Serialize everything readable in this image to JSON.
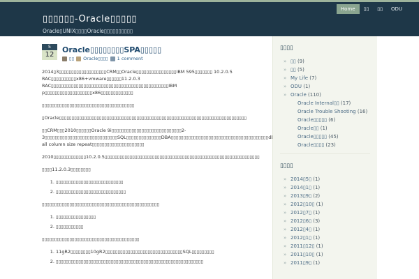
{
  "site": {
    "title": "▯▯▯▯▯▯-Oracle▯▯▯▯▯",
    "description": "Oracle▯UNIX▯▯▯▯Oracle▯▯▯▯▯▯▯▯▯▯"
  },
  "nav": [
    {
      "label": "Home",
      "active": true
    },
    {
      "label": "▯▯",
      "active": false
    },
    {
      "label": "▯▯",
      "active": false
    },
    {
      "label": "ODU",
      "active": false
    }
  ],
  "post": {
    "date_month": "5",
    "date_day": "12",
    "title": "Oracle▯▯▯▯▯▯▯▯SPA▯▯▯▯▯",
    "author": "▯▯",
    "category": "Oracle▯▯▯▯",
    "comments": "1 comment",
    "paragraphs": [
      "2014▯3▯▯▯▯▯▯▯▯▯▯▯▯▯▯▯▯▯▯▯CRM▯▯Oracle▯▯▯▯▯▯▯▯▯▯▯▯▯▯▯▯IBM 595▯▯▯▯▯▯▯ 10.2.0.5 RAC▯▯▯▯▯▯▯▯▯▯x86+vmware▯▯▯▯▯▯11.2.0.3 RAC▯▯▯▯▯▯▯▯▯▯▯▯▯▯▯▯▯▯▯▯▯▯▯▯▯▯▯▯▯▯▯▯▯▯▯▯▯▯▯▯▯▯▯▯▯▯▯IBM p▯▯▯▯▯▯▯▯▯▯▯▯▯▯▯▯▯▯▯x86▯▯▯▯▯▯▯▯▯▯▯▯▯",
      "▯▯▯▯▯▯▯▯▯▯▯▯▯▯▯▯▯▯▯▯▯▯▯▯▯▯▯▯▯▯▯▯▯▯▯▯▯",
      "▯Oracle▯▯▯▯▯▯▯▯▯▯▯▯▯▯▯▯▯▯▯▯▯▯▯▯▯▯▯▯▯▯▯▯▯▯▯▯▯▯▯▯▯▯▯▯▯▯▯▯▯▯▯▯▯▯▯▯▯▯▯▯▯▯▯▯▯▯▯▯▯▯▯▯▯▯▯",
      "▯▯CRM▯▯▯2010▯▯▯▯▯▯Oracle 9i▯▯▯▯▯▯▯▯▯▯▯▯▯▯▯▯▯▯▯▯▯▯▯▯▯▯▯▯2-3▯▯▯▯▯▯▯▯▯▯▯▯▯▯▯▯▯▯▯▯▯▯▯▯▯▯▯▯▯SQL▯▯▯▯▯▯▯▯▯▯▯▯▯▯DBA▯▯▯▯▯▯▯▯▯▯▯▯▯▯▯▯▯▯▯▯▯▯▯▯▯▯▯▯▯▯▯▯▯▯▯▯▯▯▯dbms_stats.gather_table_stats▯▯method_opt▯▯▯▯for all column size repeat▯▯▯▯▯▯▯▯▯▯▯▯▯▯▯▯▯▯▯▯▯",
      "2010▯▯▯▯▯▯▯▯▯▯▯▯▯10.2.0.5▯▯▯▯▯▯▯▯▯▯▯▯▯▯▯▯▯▯▯▯▯▯▯▯▯▯▯▯▯▯▯▯▯▯▯▯▯▯▯▯▯▯▯▯▯▯▯▯▯▯▯▯▯▯▯▯▯▯▯▯▯▯",
      "▯▯▯▯11.2.0.3▯▯▯▯▯▯▯▯"
    ],
    "list1": [
      "▯▯▯▯▯▯▯▯▯▯▯▯▯▯▯▯▯▯▯▯▯▯▯▯▯▯▯",
      "▯▯▯▯▯▯▯▯▯▯▯▯▯▯▯▯▯▯▯▯▯▯▯▯▯▯▯▯"
    ],
    "paragraph_after_list1": "▯▯▯▯▯▯▯▯▯▯▯▯▯▯▯▯▯▯▯▯▯▯▯▯▯▯▯▯▯▯▯▯▯▯▯▯▯▯▯▯▯▯▯▯▯▯▯",
    "list2": [
      "▯▯▯▯▯▯▯▯▯▯▯▯▯▯▯▯",
      "▯▯▯▯▯▯▯▯▯▯▯"
    ],
    "paragraph_after_list2": "▯▯▯▯▯▯▯▯▯▯▯▯▯▯▯▯▯▯▯▯▯▯▯▯▯▯▯▯▯▯▯▯▯▯▯▯▯▯▯",
    "list3": [
      "11gR2▯▯▯▯▯▯▯▯10gR2▯▯▯▯▯▯▯▯▯▯▯▯▯▯▯▯▯▯▯▯▯▯▯▯▯▯▯▯▯▯▯SQL▯▯▯▯▯▯▯▯▯",
      "▯▯▯▯▯▯▯▯▯▯▯▯▯▯▯▯▯▯▯▯▯▯▯▯▯▯▯▯▯▯▯▯▯▯▯▯▯▯▯▯▯▯▯▯▯▯▯▯▯▯▯▯▯▯▯▯▯▯▯"
    ]
  },
  "sidebar": {
    "categories_title": "▯▯▯▯",
    "categories": [
      {
        "label": "▯▯",
        "count": "(9)"
      },
      {
        "label": "▯▯",
        "count": "(5)"
      },
      {
        "label": "My Life",
        "count": "(7)"
      },
      {
        "label": "ODU",
        "count": "(1)"
      },
      {
        "label": "Oracle",
        "count": "(110)"
      }
    ],
    "oracle_children": [
      {
        "label": "Oracle Internal▯▯",
        "count": "(17)"
      },
      {
        "label": "Oracle Trouble Shooting",
        "count": "(16)"
      },
      {
        "label": "Oracle▯▯▯▯▯",
        "count": "(6)"
      },
      {
        "label": "Oracle▯▯",
        "count": "(1)"
      },
      {
        "label": "Oracle▯▯▯▯▯",
        "count": "(45)"
      },
      {
        "label": "Oracle▯▯▯▯",
        "count": "(23)"
      }
    ],
    "archives_title": "▯▯▯▯",
    "archives": [
      {
        "label": "2014▯5▯",
        "count": "(1)"
      },
      {
        "label": "2014▯1▯",
        "count": "(1)"
      },
      {
        "label": "2013▯9▯",
        "count": "(2)"
      },
      {
        "label": "2012▯10▯",
        "count": "(1)"
      },
      {
        "label": "2012▯7▯",
        "count": "(1)"
      },
      {
        "label": "2012▯6▯",
        "count": "(3)"
      },
      {
        "label": "2012▯4▯",
        "count": "(1)"
      },
      {
        "label": "2012▯1▯",
        "count": "(1)"
      },
      {
        "label": "2011▯12▯",
        "count": "(1)"
      },
      {
        "label": "2011▯10▯",
        "count": "(1)"
      },
      {
        "label": "2011▯9▯",
        "count": "(1)"
      }
    ]
  },
  "colors": {
    "header_bg": "#1e3748",
    "nav_active": "#8aa590",
    "link": "#1f4a6e"
  }
}
